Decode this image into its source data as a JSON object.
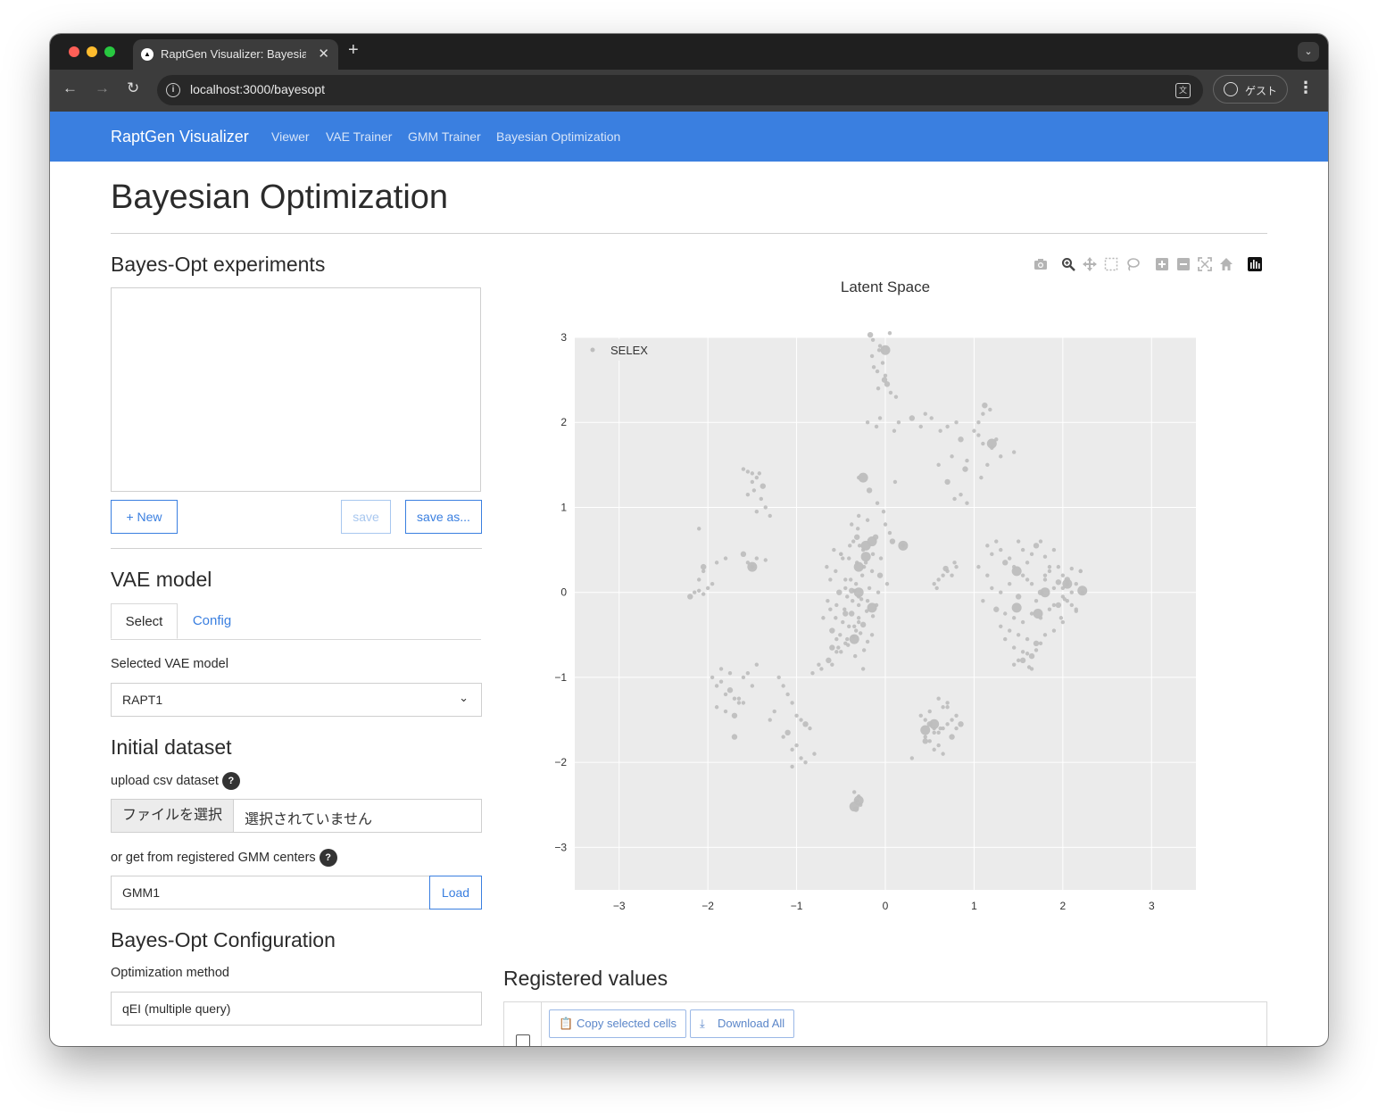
{
  "browser": {
    "tab_title": "RaptGen Visualizer: Bayesian Optimization",
    "url": "localhost:3000/bayesopt",
    "profile_label": "ゲスト"
  },
  "navbar": {
    "brand": "RaptGen Visualizer",
    "links": [
      "Viewer",
      "VAE Trainer",
      "GMM Trainer",
      "Bayesian Optimization"
    ],
    "color": "#3a7fe0"
  },
  "page": {
    "title": "Bayesian Optimization"
  },
  "experiments": {
    "heading": "Bayes-Opt experiments",
    "new_label": "+ New",
    "save_label": "save",
    "save_as_label": "save as..."
  },
  "vae": {
    "heading": "VAE model",
    "tabs": [
      "Select",
      "Config"
    ],
    "selected_label": "Selected VAE model",
    "selected_value": "RAPT1"
  },
  "dataset": {
    "heading": "Initial dataset",
    "upload_label": "upload csv dataset",
    "file_button": "ファイルを選択",
    "file_status": "選択されていません",
    "gmm_label": "or get from registered GMM centers",
    "gmm_value": "GMM1",
    "load_label": "Load",
    "help_glyph": "?"
  },
  "config": {
    "heading": "Bayes-Opt Configuration",
    "method_label": "Optimization method",
    "method_value": "qEI (multiple query)"
  },
  "modebar": {
    "icons": [
      "camera-icon",
      "zoom-icon",
      "pan-icon",
      "box-select-icon",
      "lasso-icon",
      "zoom-in-icon",
      "zoom-out-icon",
      "autoscale-icon",
      "reset-axes-icon",
      "plotly-logo-icon"
    ]
  },
  "chart_data": {
    "type": "scatter",
    "title": "Latent Space",
    "legend": [
      "SELEX"
    ],
    "legend_position": "top-left",
    "xlim": [
      -3.5,
      3.5
    ],
    "ylim": [
      -3.5,
      3.0
    ],
    "xticks": [
      "−3",
      "−2",
      "−1",
      "0",
      "1",
      "2",
      "3"
    ],
    "yticks": [
      "3",
      "2",
      "1",
      "0",
      "−1",
      "−2",
      "−3"
    ],
    "grid": true,
    "point_color": "#bdbdbd",
    "series": [
      {
        "name": "SELEX",
        "x": [
          -0.17,
          -0.14,
          -0.07,
          -0.03,
          0.05,
          -0.15,
          -0.09,
          -0.01,
          0.06,
          0.12,
          -0.08,
          0.0,
          -0.13,
          -0.06,
          0.02,
          -0.2,
          -0.1,
          -0.06,
          0.1,
          0.15,
          -0.3,
          -0.18,
          -0.09,
          -0.02,
          0.11,
          -0.38,
          -0.31,
          -0.2,
          -0.11,
          0.05,
          -0.36,
          -0.29,
          -0.25,
          -0.14,
          -0.05,
          0.08,
          0.2,
          -0.5,
          -0.41,
          -0.32,
          -0.24,
          -0.15,
          -0.06,
          -0.45,
          -0.33,
          -0.26,
          -0.18,
          -0.08,
          0.02,
          -0.52,
          -0.43,
          -0.35,
          -0.27,
          -0.2,
          -0.1,
          -0.46,
          -0.38,
          -0.3,
          -0.21,
          -0.14,
          -0.48,
          -0.41,
          -0.33,
          -0.25,
          -0.15,
          -0.55,
          -0.45,
          -0.36,
          -0.28,
          -0.2,
          -0.6,
          -0.5,
          -0.42,
          -0.34,
          -0.24,
          -0.62,
          -0.55,
          -0.45,
          -0.37,
          -0.3,
          -0.22,
          -0.58,
          -0.5,
          -0.4,
          -0.32,
          -0.66,
          -0.56,
          -0.48,
          -0.39,
          -0.3,
          -0.7,
          -0.6,
          -0.51,
          -0.43,
          -0.35,
          -0.65,
          -0.56,
          -0.45,
          -0.38,
          -0.3,
          -0.62,
          -0.25,
          0.0,
          0.2,
          -0.75,
          -0.64,
          -0.53,
          -0.82,
          -0.72,
          -0.6,
          -0.55,
          -0.3,
          0.3,
          0.4,
          0.45,
          0.52,
          0.62,
          0.7,
          0.8,
          0.85,
          0.75,
          0.6,
          1.0,
          1.05,
          1.1,
          1.05,
          1.12,
          1.18,
          1.1,
          1.2,
          1.25,
          1.3,
          1.45,
          0.9,
          0.92,
          1.15,
          1.08,
          0.78,
          0.85,
          0.92,
          0.7,
          -1.6,
          -1.55,
          -1.5,
          -1.45,
          -1.5,
          -1.42,
          -1.38,
          -1.48,
          -1.55,
          -1.4,
          -1.35,
          -1.45,
          -1.3,
          -2.2,
          -2.15,
          -2.1,
          -2.05,
          -2.0,
          -1.95,
          -2.1,
          -2.05,
          -1.9,
          -1.8,
          -1.55,
          -1.5,
          -1.45,
          -1.35,
          -1.6,
          -2.05,
          -2.1,
          -1.95,
          -1.9,
          -1.85,
          -1.8,
          -1.75,
          -1.7,
          -1.65,
          -1.6,
          -1.55,
          -1.9,
          -1.8,
          -1.7,
          -1.6,
          -1.85,
          -1.75,
          -1.65,
          -1.5,
          -1.45,
          -1.7,
          -1.2,
          -1.15,
          -1.1,
          -1.05,
          -1.0,
          -0.95,
          -0.9,
          -0.85,
          -1.15,
          -1.05,
          -0.95,
          -0.8,
          -1.25,
          -1.1,
          -1.0,
          -0.9,
          -1.3,
          -1.05,
          0.4,
          0.45,
          0.5,
          0.55,
          0.6,
          0.65,
          0.7,
          0.75,
          0.8,
          0.85,
          0.45,
          0.5,
          0.55,
          0.6,
          0.65,
          0.7,
          0.75,
          0.8,
          0.5,
          0.6,
          0.7,
          0.55,
          0.65,
          0.45,
          0.62,
          0.3,
          -0.35,
          -0.3,
          -0.32,
          -0.28,
          -0.33,
          0.6,
          0.65,
          0.7,
          0.75,
          0.8,
          0.55,
          0.68,
          0.78,
          0.58,
          1.15,
          1.2,
          1.25,
          1.3,
          1.35,
          1.4,
          1.45,
          1.5,
          1.55,
          1.6,
          1.65,
          1.7,
          1.75,
          1.8,
          1.85,
          1.9,
          1.95,
          2.0,
          2.05,
          2.1,
          2.15,
          2.2,
          1.2,
          1.3,
          1.4,
          1.5,
          1.6,
          1.7,
          1.8,
          1.9,
          2.0,
          2.1,
          1.25,
          1.35,
          1.45,
          1.55,
          1.65,
          1.75,
          1.85,
          1.95,
          2.05,
          2.15,
          1.3,
          1.4,
          1.5,
          1.6,
          1.7,
          1.8,
          1.9,
          2.0,
          1.35,
          1.45,
          1.55,
          1.65,
          1.75,
          1.5,
          1.6,
          1.7,
          1.45,
          1.65,
          1.55,
          1.62,
          1.15,
          1.05,
          1.1,
          1.55,
          1.65,
          1.75,
          1.8,
          1.9,
          2.0,
          2.1,
          2.2,
          1.85,
          1.95,
          2.05,
          2.15,
          2.22,
          1.98,
          2.02
        ],
        "y": [
          3.03,
          2.97,
          2.85,
          2.7,
          3.05,
          2.78,
          2.6,
          2.5,
          2.35,
          2.3,
          2.4,
          2.55,
          2.65,
          2.9,
          2.45,
          2.0,
          1.95,
          2.05,
          1.9,
          2.0,
          1.35,
          1.2,
          1.05,
          0.95,
          1.3,
          0.8,
          0.75,
          0.85,
          0.65,
          0.7,
          0.6,
          0.55,
          0.5,
          0.45,
          0.4,
          0.6,
          0.55,
          0.45,
          0.4,
          0.35,
          0.3,
          0.25,
          0.2,
          0.15,
          0.1,
          0.2,
          0.05,
          0.0,
          0.1,
          0.0,
          -0.05,
          0.02,
          -0.08,
          -0.1,
          -0.15,
          -0.2,
          -0.25,
          -0.3,
          -0.22,
          -0.28,
          -0.35,
          -0.4,
          -0.45,
          -0.38,
          -0.5,
          -0.55,
          -0.6,
          -0.52,
          -0.48,
          -0.58,
          -0.65,
          -0.7,
          -0.62,
          -0.75,
          -0.68,
          -0.2,
          -0.15,
          -0.25,
          -0.1,
          -0.05,
          0.35,
          0.5,
          0.45,
          0.55,
          0.65,
          0.3,
          0.25,
          0.4,
          0.15,
          -0.35,
          -0.3,
          -0.45,
          -0.5,
          -0.55,
          -0.4,
          -0.1,
          -0.3,
          0.05,
          0.02,
          -0.15,
          0.15,
          -0.9,
          0.8,
          0.55,
          -0.85,
          -0.8,
          -0.65,
          -0.95,
          -0.9,
          -0.85,
          -0.7,
          0.9,
          2.05,
          1.95,
          2.1,
          2.05,
          1.9,
          1.95,
          2.0,
          1.8,
          1.6,
          1.5,
          1.9,
          2.0,
          2.1,
          1.85,
          2.2,
          2.15,
          1.75,
          1.7,
          1.8,
          1.6,
          1.65,
          1.45,
          1.55,
          1.5,
          1.35,
          1.1,
          1.15,
          1.05,
          1.3,
          1.45,
          1.42,
          1.4,
          1.35,
          1.3,
          1.4,
          1.25,
          1.2,
          1.15,
          1.1,
          1.0,
          0.95,
          0.9,
          -0.05,
          0.0,
          0.02,
          -0.02,
          0.05,
          0.1,
          0.15,
          0.3,
          0.35,
          0.4,
          0.35,
          0.3,
          0.4,
          0.38,
          0.45,
          0.25,
          0.75,
          -1.0,
          -1.1,
          -1.05,
          -1.2,
          -1.15,
          -1.25,
          -1.3,
          -1.0,
          -0.95,
          -1.35,
          -1.4,
          -1.45,
          -1.3,
          -0.9,
          -0.95,
          -1.25,
          -1.1,
          -0.85,
          -1.7,
          -1.0,
          -1.1,
          -1.2,
          -1.3,
          -1.45,
          -1.5,
          -1.55,
          -1.6,
          -1.7,
          -1.85,
          -1.95,
          -1.9,
          -1.4,
          -1.65,
          -1.8,
          -2.0,
          -1.5,
          -2.05,
          -1.45,
          -1.5,
          -1.55,
          -1.6,
          -1.65,
          -1.6,
          -1.55,
          -1.5,
          -1.45,
          -1.55,
          -1.7,
          -1.75,
          -1.65,
          -1.8,
          -1.35,
          -1.3,
          -1.7,
          -1.6,
          -1.4,
          -1.25,
          -1.35,
          -1.85,
          -1.9,
          -1.75,
          -1.6,
          -1.95,
          -2.35,
          -2.4,
          -2.45,
          -2.5,
          -2.55,
          0.15,
          0.2,
          0.25,
          0.2,
          0.3,
          0.1,
          0.28,
          0.35,
          0.05,
          0.55,
          0.45,
          0.6,
          0.5,
          0.35,
          0.4,
          0.3,
          0.6,
          0.5,
          0.35,
          0.45,
          0.55,
          0.6,
          0.42,
          0.25,
          0.5,
          0.3,
          0.2,
          0.15,
          0.28,
          0.1,
          0.25,
          0.05,
          0.0,
          0.1,
          -0.05,
          0.15,
          -0.1,
          0.2,
          -0.15,
          0.05,
          0.0,
          -0.2,
          -0.25,
          -0.3,
          -0.35,
          -0.25,
          -0.3,
          -0.2,
          -0.15,
          -0.1,
          -0.22,
          -0.4,
          -0.45,
          -0.5,
          -0.55,
          -0.6,
          -0.5,
          -0.45,
          -0.35,
          -0.55,
          -0.65,
          -0.7,
          -0.75,
          -0.6,
          -0.8,
          -0.72,
          -0.68,
          -0.85,
          -0.9,
          -0.8,
          -0.88,
          0.2,
          0.3,
          -0.1,
          0.2,
          0.1,
          0.0,
          0.15,
          0.05,
          -0.05,
          -0.15,
          0.25,
          0.3,
          0.12,
          0.1,
          -0.2,
          0.0,
          -0.3,
          -0.08
        ]
      }
    ],
    "large_points": [
      [
        0.0,
        2.85
      ],
      [
        -0.25,
        1.35
      ],
      [
        0.2,
        0.55
      ],
      [
        -0.22,
        0.55
      ],
      [
        -0.3,
        0.3
      ],
      [
        -0.3,
        0.0
      ],
      [
        -0.15,
        -0.18
      ],
      [
        1.48,
        0.25
      ],
      [
        1.8,
        0.0
      ],
      [
        1.48,
        -0.18
      ],
      [
        2.05,
        0.1
      ],
      [
        0.55,
        -1.55
      ],
      [
        0.45,
        -1.62
      ],
      [
        -0.3,
        -2.45
      ],
      [
        -0.35,
        -2.52
      ],
      [
        -1.5,
        0.3
      ],
      [
        -0.22,
        0.42
      ],
      [
        -0.35,
        -0.55
      ],
      [
        1.72,
        -0.25
      ],
      [
        2.22,
        0.02
      ],
      [
        -0.15,
        0.6
      ],
      [
        1.2,
        1.75
      ]
    ]
  },
  "registered": {
    "heading": "Registered values",
    "copy_label": "Copy selected cells",
    "download_label": "Download All"
  }
}
